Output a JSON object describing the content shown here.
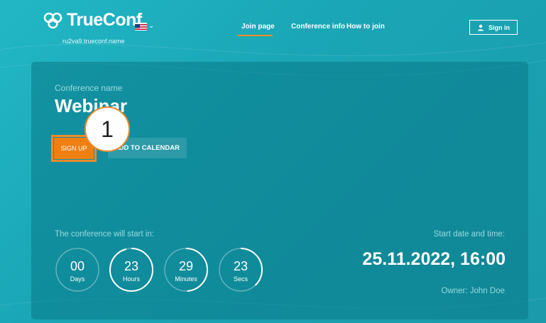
{
  "header": {
    "logo_text": "TrueConf",
    "domain": "ru2va9.trueconf.name",
    "language_icon": "us-flag-icon",
    "nav": [
      {
        "label": "Join page",
        "active": true
      },
      {
        "label": "Conference info",
        "active": false
      },
      {
        "label": "How to join",
        "active": false
      }
    ],
    "sign_in_label": "Sign in",
    "sign_in_icon": "user-icon"
  },
  "conference": {
    "label": "Conference name",
    "name": "Webinar",
    "signup_label": "SIGN UP",
    "add_calendar_label": "ADD TO CALENDAR",
    "step_marker": "1",
    "start_label": "The conference will start in:",
    "countdown": [
      {
        "value": "00",
        "unit": "Days",
        "fraction": 0.0
      },
      {
        "value": "23",
        "unit": "Hours",
        "fraction": 0.96
      },
      {
        "value": "29",
        "unit": "Minutes",
        "fraction": 0.49
      },
      {
        "value": "23",
        "unit": "Secs",
        "fraction": 0.38
      }
    ],
    "date_label": "Start date and time:",
    "date_value": "25.11.2022, 16:00",
    "owner": "Owner: John Doe"
  },
  "colors": {
    "accent": "#f07f12",
    "background": "#1ea8b8"
  }
}
